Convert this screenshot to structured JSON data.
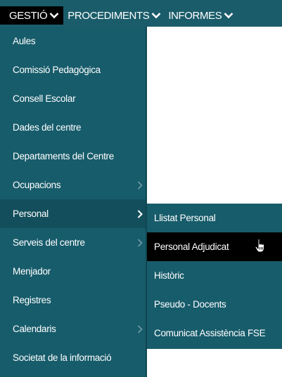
{
  "navbar": {
    "items": [
      {
        "label": "GESTIÓ",
        "active": true
      },
      {
        "label": "PROCEDIMENTS",
        "active": false
      },
      {
        "label": "INFORMES",
        "active": false
      }
    ]
  },
  "menu": {
    "items": [
      {
        "label": "Aules"
      },
      {
        "label": "Comissió Pedagògica"
      },
      {
        "label": "Consell Escolar"
      },
      {
        "label": "Dades del centre"
      },
      {
        "label": "Departaments del Centre"
      },
      {
        "label": "Ocupacions",
        "has_submenu": true
      },
      {
        "label": "Personal",
        "has_submenu": true,
        "open": true
      },
      {
        "label": "Serveis del centre",
        "has_submenu": true
      },
      {
        "label": "Menjador"
      },
      {
        "label": "Registres"
      },
      {
        "label": "Calendaris",
        "has_submenu": true
      },
      {
        "label": "Societat de la informació"
      }
    ]
  },
  "submenu": {
    "items": [
      {
        "label": "Llistat Personal"
      },
      {
        "label": "Personal Adjudicat",
        "hovered": true
      },
      {
        "label": "Històric"
      },
      {
        "label": "Pseudo - Docents"
      },
      {
        "label": "Comunicat Assistència FSE"
      }
    ]
  },
  "icons": {
    "dropdown": "chevron-down-icon",
    "submenu": "chevron-right-icon",
    "cursor": "hand-pointer-icon"
  },
  "colors": {
    "navbar_bg": "#1a5c6a",
    "menu_bg": "#175c6b",
    "active_bg": "#000000",
    "text": "#ffffff"
  }
}
